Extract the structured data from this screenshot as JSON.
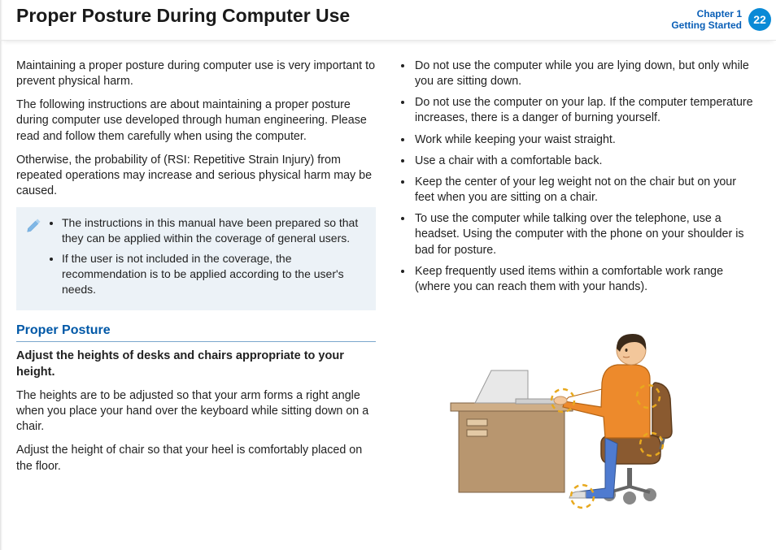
{
  "header": {
    "title": "Proper Posture During Computer Use",
    "chapter_line1": "Chapter 1",
    "chapter_line2": "Getting Started",
    "page_number": "22"
  },
  "left": {
    "p1": "Maintaining a proper posture during computer use is very important to prevent physical harm.",
    "p2": "The following instructions are about maintaining a proper posture during computer use developed through human engineering. Please read and follow them carefully when using the computer.",
    "p3": "Otherwise, the probability of (RSI: Repetitive Strain Injury) from repeated operations may increase and serious physical harm may be caused.",
    "note": {
      "items": [
        "The instructions in this manual have been prepared so that they can be applied within the coverage of general users.",
        "If the user is not included in the coverage, the recommendation is to be applied according to the user's needs."
      ]
    },
    "section_heading": "Proper Posture",
    "sub_heading": "Adjust the heights of desks and chairs appropriate to your height.",
    "p4": "The heights are to be adjusted so that your arm forms a right angle when you place your hand over the keyboard while sitting down on a chair.",
    "p5": "Adjust the height of chair so that your heel is comfortably placed on the floor."
  },
  "right": {
    "bullets": [
      "Do not use the computer while you are lying down, but only while you are sitting down.",
      "Do not use the computer on your lap. If the computer temperature increases, there is a danger of burning yourself.",
      "Work while keeping your waist straight.",
      "Use a chair with a comfortable back.",
      "Keep the center of your leg weight not on the chair but on your feet when you are sitting on a chair.",
      "To use the computer while talking over the telephone, use a headset. Using the computer with the phone on your shoulder is bad for posture.",
      "Keep frequently used items within a comfortable work range (where you can reach them with your hands)."
    ]
  }
}
